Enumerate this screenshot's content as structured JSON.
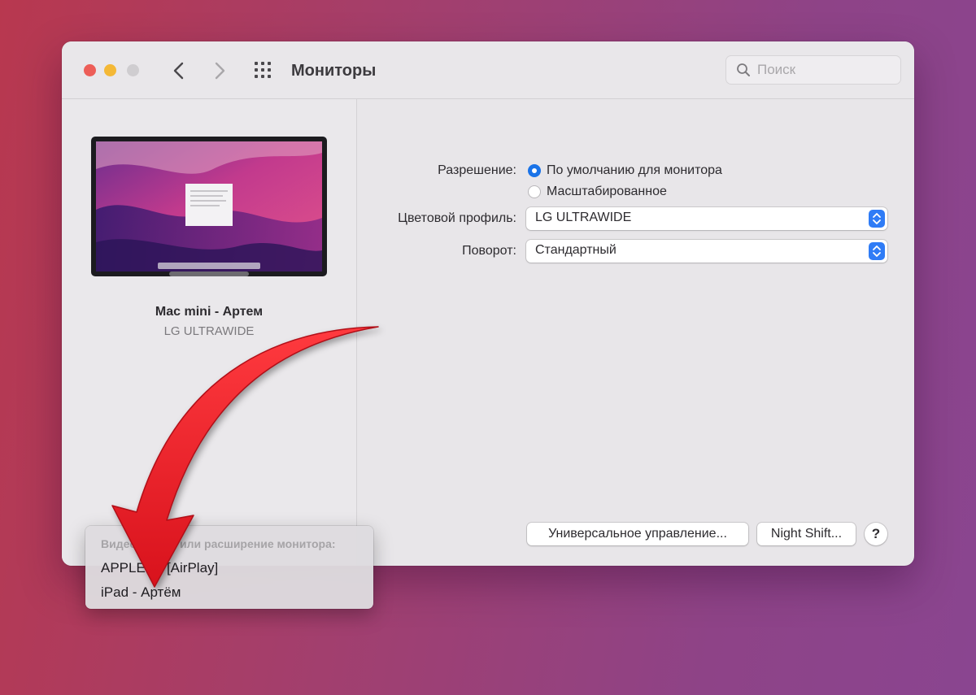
{
  "window": {
    "title": "Мониторы",
    "search_placeholder": "Поиск"
  },
  "sidebar": {
    "display_name": "Mac mini - Артем",
    "display_model": "LG ULTRAWIDE"
  },
  "settings": {
    "resolution_label": "Разрешение:",
    "resolution_options": [
      "По умолчанию для монитора",
      "Масштабированное"
    ],
    "resolution_selected": "По умолчанию для монитора",
    "color_profile_label": "Цветовой профиль:",
    "color_profile_value": "LG ULTRAWIDE",
    "rotation_label": "Поворот:",
    "rotation_value": "Стандартный"
  },
  "buttons": {
    "universal_control": "Универсальное управление...",
    "night_shift": "Night Shift...",
    "help": "?"
  },
  "popup": {
    "header": "Видеоповтор или расширение монитора:",
    "items": [
      "APPLE TV[AirPlay]",
      "iPad - Артём"
    ]
  },
  "colors": {
    "accent": "#1a73e8",
    "arrow": "#e8212b",
    "close": "#ed5e58",
    "minimize": "#f4b836"
  },
  "icons": [
    "chevron-left-icon",
    "chevron-right-icon",
    "grid-icon",
    "search-icon",
    "monitor-icon",
    "arrow-annotation-icon"
  ]
}
